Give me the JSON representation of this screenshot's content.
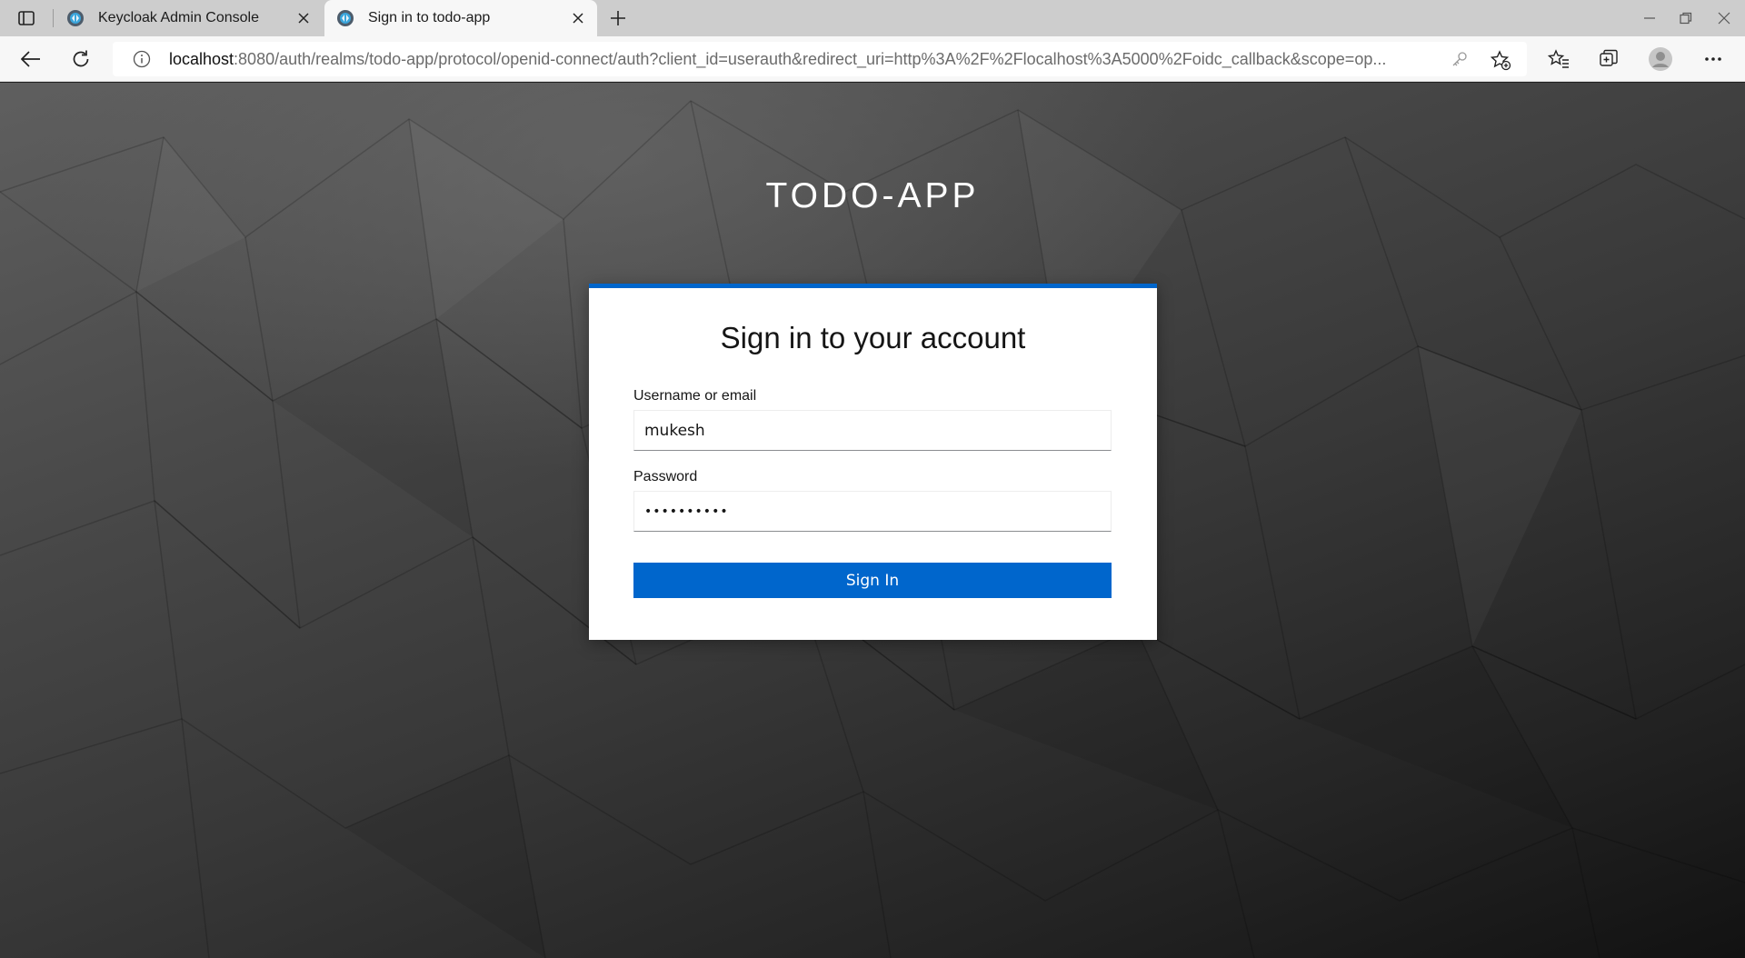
{
  "browser": {
    "tabs": [
      {
        "title": "Keycloak Admin Console",
        "active": false,
        "icon": "keycloak-favicon"
      },
      {
        "title": "Sign in to todo-app",
        "active": true,
        "icon": "keycloak-favicon"
      }
    ],
    "address": {
      "host": "localhost",
      "rest": ":8080/auth/realms/todo-app/protocol/openid-connect/auth?client_id=userauth&redirect_uri=http%3A%2F%2Flocalhost%3A5000%2Foidc_callback&scope=op..."
    },
    "accent": "#0066cc"
  },
  "page": {
    "realm_title": "TODO-APP",
    "card_title": "Sign in to your account",
    "username": {
      "label": "Username or email",
      "value": "mukesh"
    },
    "password": {
      "label": "Password",
      "masked_value": "••••••••••"
    },
    "submit_label": "Sign In"
  }
}
